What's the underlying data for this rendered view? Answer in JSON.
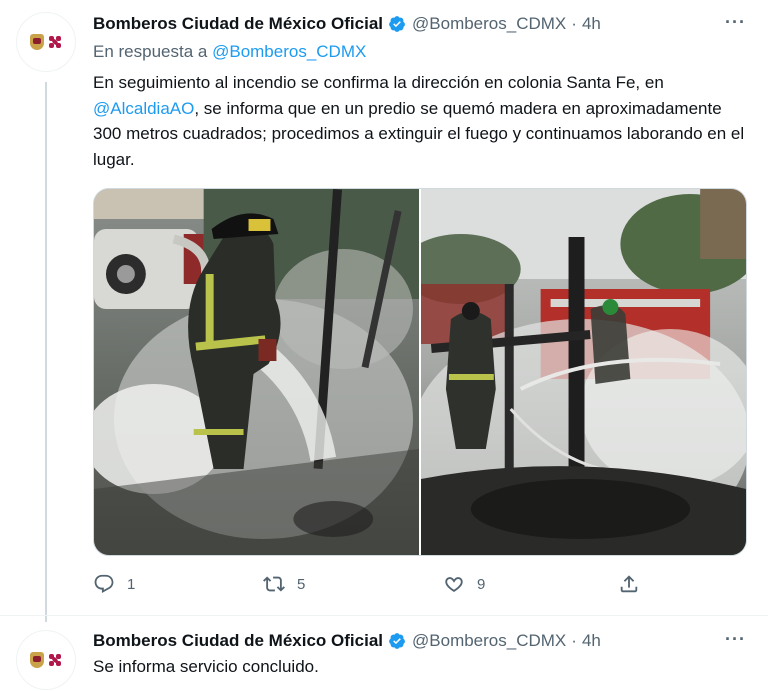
{
  "tweets": [
    {
      "author_name": "Bomberos Ciudad de México Oficial",
      "handle": "@Bomberos_CDMX",
      "separator": "·",
      "time": "4h",
      "more": "···",
      "reply_prefix": "En respuesta a",
      "reply_to": "@Bomberos_CDMX",
      "text_part1": "En seguimiento al incendio se confirma la dirección en colonia Santa Fe, en ",
      "mention": "@AlcaldiaAO",
      "text_part2": ", se informa que en un predio se quemó madera en aproximadamente 300 metros cuadrados; procedimos a extinguir el fuego y continuamos laborando en el lugar.",
      "actions": {
        "replies": "1",
        "retweets": "5",
        "likes": "9"
      }
    },
    {
      "author_name": "Bomberos Ciudad de México Oficial",
      "handle": "@Bomberos_CDMX",
      "separator": "·",
      "time": "4h",
      "more": "···",
      "text": "Se informa servicio concluido."
    }
  ],
  "colors": {
    "text": "#0f1419",
    "secondary": "#536471",
    "link": "#1d9bf0",
    "verified": "#1d9bf0",
    "brand_crest": "#b0184a"
  },
  "icons": [
    "verified-badge-icon",
    "more-options-icon",
    "reply-icon",
    "retweet-icon",
    "like-icon",
    "share-icon"
  ]
}
